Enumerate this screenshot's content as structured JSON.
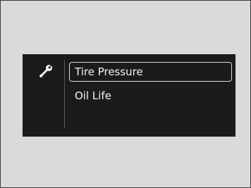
{
  "icon": {
    "name": "wrench-icon"
  },
  "menu": {
    "items": [
      {
        "label": "Tire Pressure",
        "selected": true
      },
      {
        "label": "Oil Life",
        "selected": false
      }
    ]
  },
  "colors": {
    "background": "#dadada",
    "screen": "#1b1b1b",
    "text": "#f3f3f3",
    "selection_outline": "#d9d9d9"
  }
}
